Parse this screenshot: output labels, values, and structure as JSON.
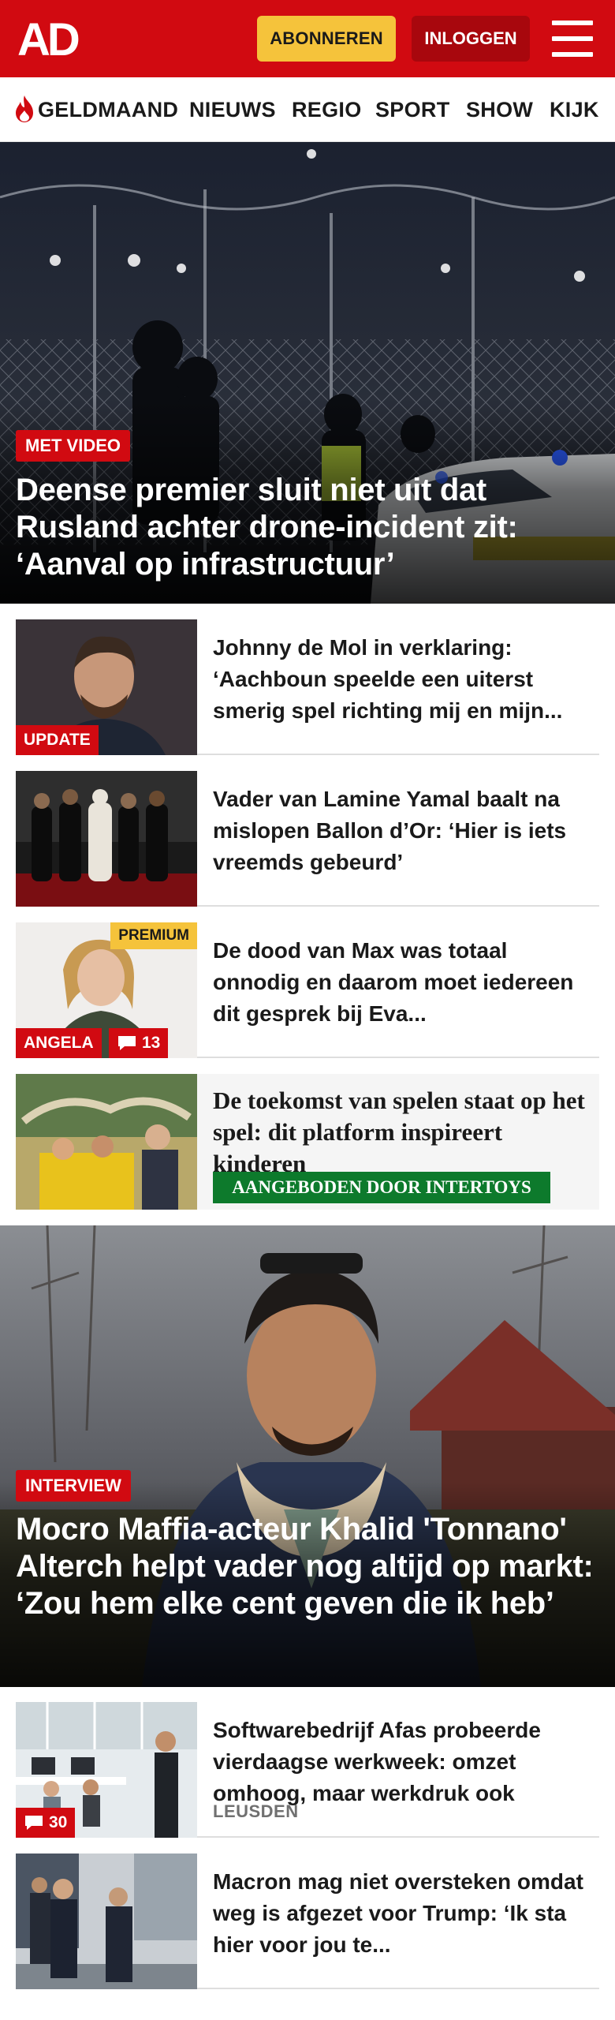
{
  "header": {
    "logo_text": "AD",
    "subscribe_label": "ABONNEREN",
    "login_label": "INLOGGEN",
    "menu_icon": "hamburger-menu-icon",
    "brand_color": "#d10a11",
    "subscribe_color": "#f5c33b"
  },
  "nav": {
    "items": [
      {
        "label": "GELDMAAND",
        "icon": "flame-icon"
      },
      {
        "label": "NIEUWS"
      },
      {
        "label": "REGIO"
      },
      {
        "label": "SPORT"
      },
      {
        "label": "SHOW"
      },
      {
        "label": "KIJK"
      }
    ]
  },
  "hero1": {
    "label": "MET VIDEO",
    "title": "Deense premier sluit niet uit dat Rusland achter drone-incident zit: ‘Aanval op infrastructuur’"
  },
  "articles": [
    {
      "title": "Johnny de Mol in verklaring: ‘Aachboun speelde een uiterst smerig spel richting mij en mijn...",
      "label": "UPDATE"
    },
    {
      "title": "Vader van Lamine Yamal baalt na mislopen Ballon d’Or: ‘Hier is iets vreemds gebeurd’"
    },
    {
      "title": "De dood van Max was totaal onnodig en daarom moet iedereen dit gesprek bij Eva...",
      "label": "ANGELA",
      "comments": "13",
      "premium": "PREMIUM"
    },
    {
      "title": "De toekomst van spelen staat op het spel: dit platform inspireert kinderen",
      "sponsor": "AANGEBODEN DOOR INTERTOYS"
    }
  ],
  "hero2": {
    "label": "INTERVIEW",
    "title": "Mocro Maffia-acteur Khalid 'Tonnano' Alterch helpt vader nog altijd op markt: ‘Zou hem elke cent geven die ik heb’"
  },
  "articles2": [
    {
      "title": "Softwarebedrijf Afas probeerde vierdaagse werkweek: omzet omhoog, maar werkdruk ook",
      "location": "LEUSDEN",
      "comments": "30"
    },
    {
      "title": "Macron mag niet oversteken omdat weg is afgezet voor Trump: ‘Ik sta hier voor jou te..."
    }
  ]
}
